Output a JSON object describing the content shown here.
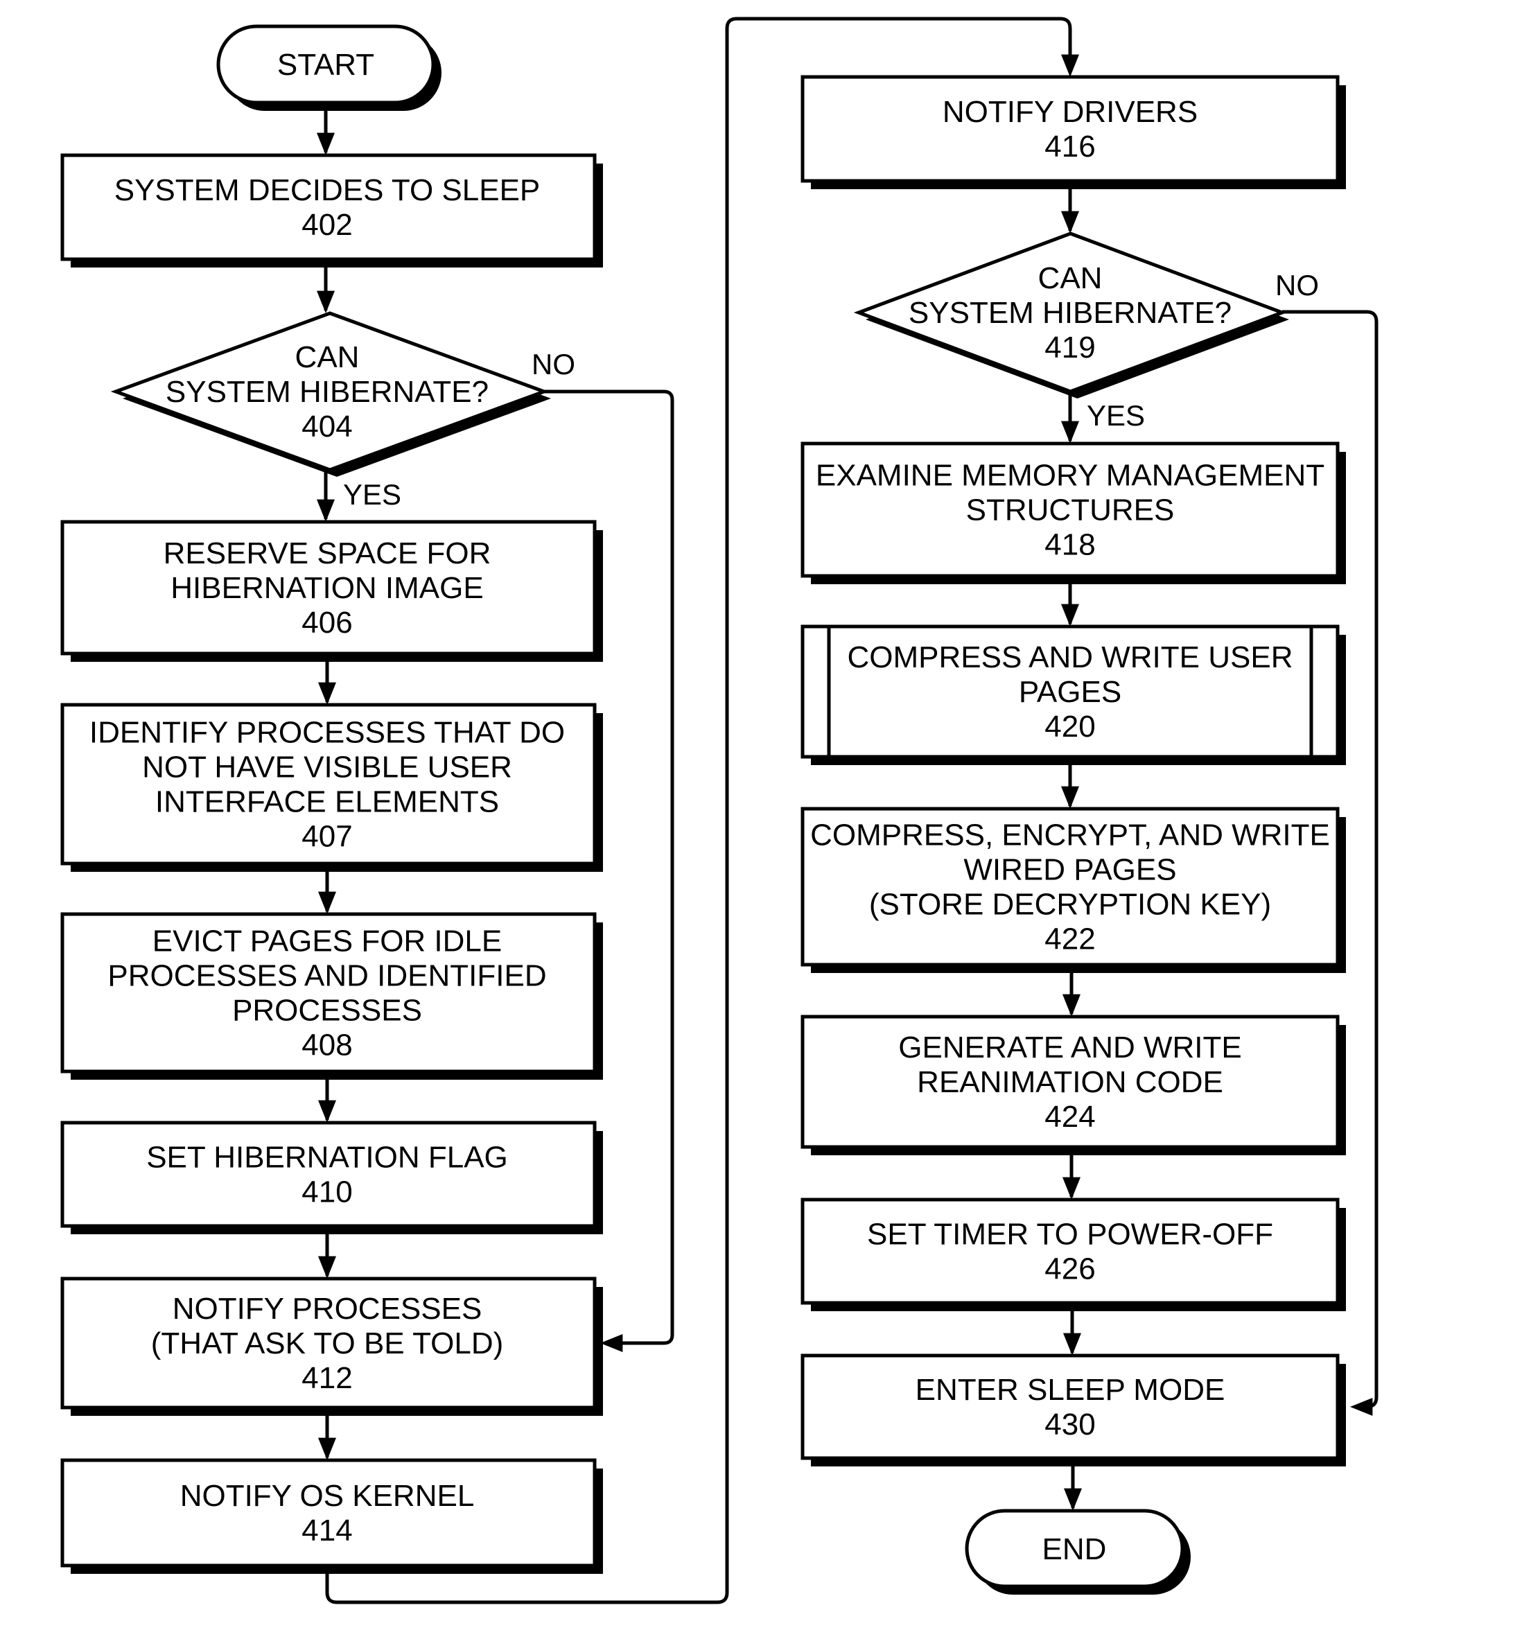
{
  "diagram": {
    "type": "flowchart",
    "terminals": {
      "start": "START",
      "end": "END"
    },
    "left_column": [
      {
        "id": "402",
        "kind": "process",
        "lines": [
          "SYSTEM DECIDES TO SLEEP",
          "402"
        ]
      },
      {
        "id": "404",
        "kind": "decision",
        "lines": [
          "CAN",
          "SYSTEM HIBERNATE?",
          "404"
        ],
        "yes_label": "YES",
        "no_label": "NO"
      },
      {
        "id": "406",
        "kind": "process",
        "lines": [
          "RESERVE SPACE FOR",
          "HIBERNATION IMAGE",
          "406"
        ]
      },
      {
        "id": "407",
        "kind": "process",
        "lines": [
          "IDENTIFY PROCESSES THAT DO",
          "NOT HAVE VISIBLE USER",
          "INTERFACE ELEMENTS",
          "407"
        ]
      },
      {
        "id": "408",
        "kind": "process",
        "lines": [
          "EVICT PAGES FOR IDLE",
          "PROCESSES AND IDENTIFIED",
          "PROCESSES",
          "408"
        ]
      },
      {
        "id": "410",
        "kind": "process",
        "lines": [
          "SET HIBERNATION FLAG",
          "410"
        ]
      },
      {
        "id": "412",
        "kind": "process",
        "lines": [
          "NOTIFY PROCESSES",
          "(THAT ASK TO BE TOLD)",
          "412"
        ]
      },
      {
        "id": "414",
        "kind": "process",
        "lines": [
          "NOTIFY OS KERNEL",
          "414"
        ]
      }
    ],
    "right_column": [
      {
        "id": "416",
        "kind": "process",
        "lines": [
          "NOTIFY DRIVERS",
          "416"
        ]
      },
      {
        "id": "419",
        "kind": "decision",
        "lines": [
          "CAN",
          "SYSTEM HIBERNATE?",
          "419"
        ],
        "yes_label": "YES",
        "no_label": "NO"
      },
      {
        "id": "418",
        "kind": "process",
        "lines": [
          "EXAMINE MEMORY MANAGEMENT",
          "STRUCTURES",
          "418"
        ]
      },
      {
        "id": "420",
        "kind": "subprocess",
        "lines": [
          "COMPRESS AND WRITE USER",
          "PAGES",
          "420"
        ]
      },
      {
        "id": "422",
        "kind": "process",
        "lines": [
          "COMPRESS, ENCRYPT, AND WRITE",
          "WIRED PAGES",
          "(STORE DECRYPTION KEY)",
          "422"
        ]
      },
      {
        "id": "424",
        "kind": "process",
        "lines": [
          "GENERATE AND WRITE",
          "REANIMATION CODE",
          "424"
        ]
      },
      {
        "id": "426",
        "kind": "process",
        "lines": [
          "SET TIMER TO POWER-OFF",
          "426"
        ]
      },
      {
        "id": "430",
        "kind": "process",
        "lines": [
          "ENTER SLEEP MODE",
          "430"
        ]
      }
    ],
    "edges": [
      {
        "from": "START",
        "to": "402"
      },
      {
        "from": "402",
        "to": "404"
      },
      {
        "from": "404",
        "to": "406",
        "label": "YES"
      },
      {
        "from": "404",
        "to": "412",
        "label": "NO"
      },
      {
        "from": "406",
        "to": "407"
      },
      {
        "from": "407",
        "to": "408"
      },
      {
        "from": "408",
        "to": "410"
      },
      {
        "from": "410",
        "to": "412"
      },
      {
        "from": "412",
        "to": "414"
      },
      {
        "from": "414",
        "to": "416"
      },
      {
        "from": "416",
        "to": "419"
      },
      {
        "from": "419",
        "to": "418",
        "label": "YES"
      },
      {
        "from": "419",
        "to": "430",
        "label": "NO"
      },
      {
        "from": "418",
        "to": "420"
      },
      {
        "from": "420",
        "to": "422"
      },
      {
        "from": "422",
        "to": "424"
      },
      {
        "from": "424",
        "to": "426"
      },
      {
        "from": "426",
        "to": "430"
      },
      {
        "from": "430",
        "to": "END"
      }
    ]
  }
}
